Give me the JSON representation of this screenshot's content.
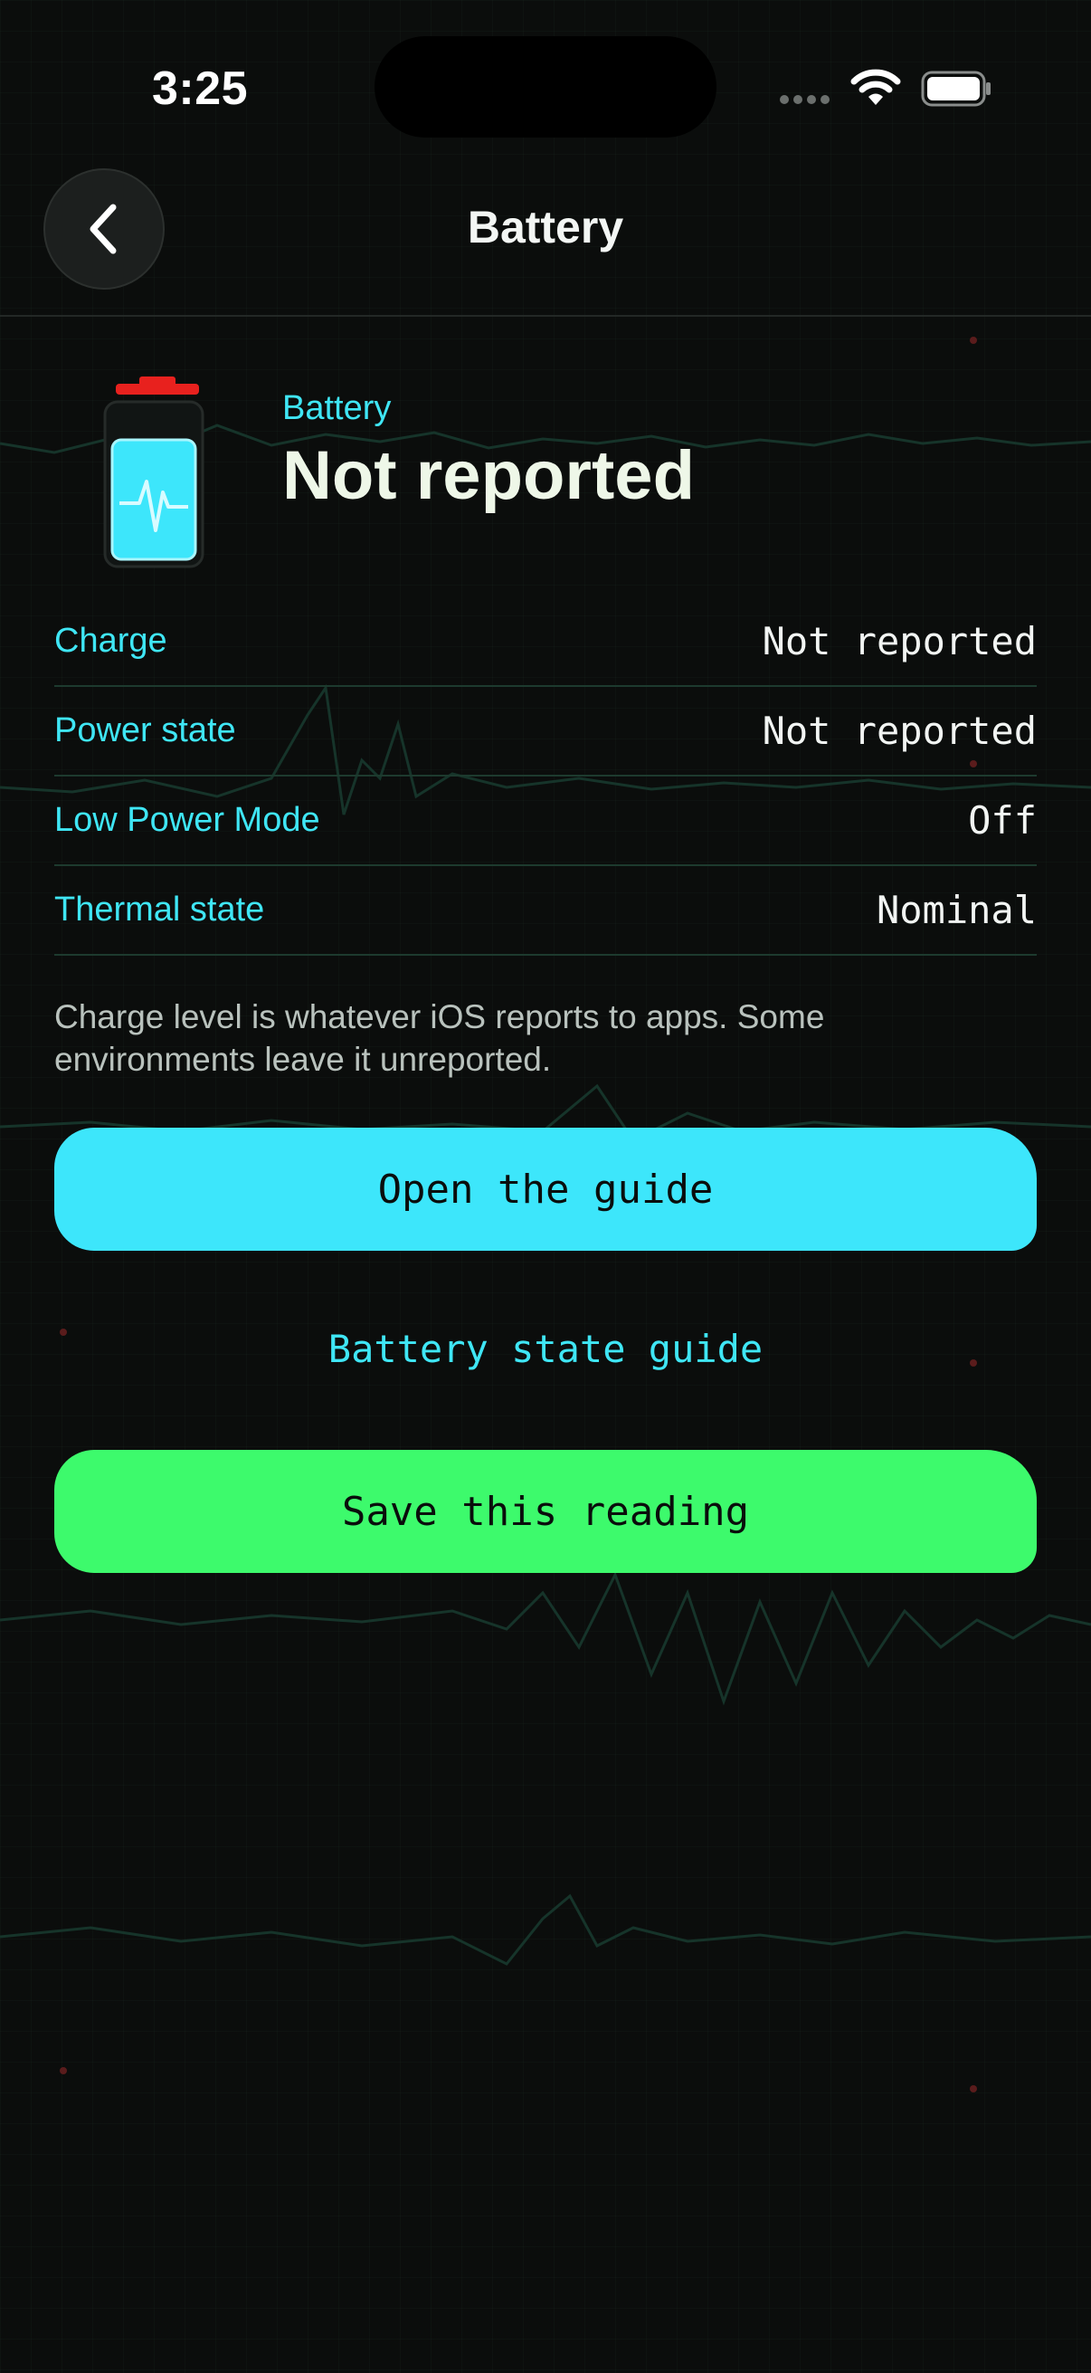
{
  "status_bar": {
    "time": "3:25",
    "icons": [
      "cellular-signal-icon",
      "wifi-icon",
      "battery-icon"
    ]
  },
  "nav": {
    "back_icon": "chevron-left-icon",
    "title": "Battery"
  },
  "hero": {
    "icon": "battery-pulse-icon",
    "label": "Battery",
    "value": "Not reported"
  },
  "rows": [
    {
      "label": "Charge",
      "value": "Not reported"
    },
    {
      "label": "Power state",
      "value": "Not reported"
    },
    {
      "label": "Low Power Mode",
      "value": "Off"
    },
    {
      "label": "Thermal state",
      "value": "Nominal"
    }
  ],
  "note": "Charge level is whatever iOS reports to apps. Some environments leave it unreported.",
  "actions": {
    "open_guide": "Open the guide",
    "guide_link": "Battery state guide",
    "save": "Save this reading"
  },
  "colors": {
    "background": "#0b0d0c",
    "cyan_accent": "#3de6fb",
    "green_accent": "#3dfa6c",
    "battery_cap": "#e8211e"
  }
}
